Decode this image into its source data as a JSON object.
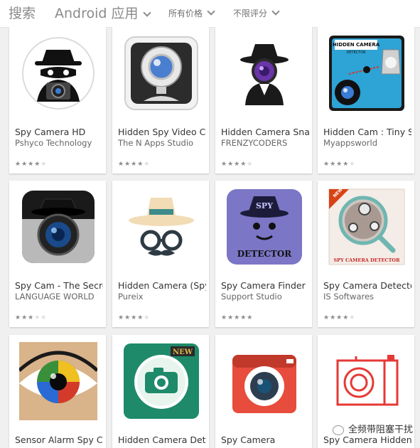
{
  "header": {
    "search_label": "搜索",
    "category_label": "Android 应用",
    "price_filter": "所有价格",
    "rating_filter": "不限评分"
  },
  "apps": [
    {
      "title": "Spy Camera HD",
      "developer": "Pshyco Technology",
      "rating": 4
    },
    {
      "title": "Hidden Spy Video Camera",
      "developer": "The N Apps Studio",
      "rating": 4
    },
    {
      "title": "Hidden Camera Snap",
      "developer": "FRENZYCODERS",
      "rating": 4.5
    },
    {
      "title": "Hidden Cam : Tiny Spy",
      "developer": "Myappsworld",
      "rating": 4.5
    },
    {
      "title": "Spy Cam - The Secret",
      "developer": "LANGUAGE WORLD",
      "rating": 3.5
    },
    {
      "title": "Hidden Camera (Spy)",
      "developer": "Pureix",
      "rating": 4
    },
    {
      "title": "Spy Camera Finder",
      "developer": "Support Studio",
      "rating": 5
    },
    {
      "title": "Spy Camera Detector",
      "developer": "IS Softwares",
      "rating": 4.5
    },
    {
      "title": "Sensor Alarm Spy Camera",
      "developer": "",
      "rating": 0
    },
    {
      "title": "Hidden Camera Detector",
      "developer": "",
      "rating": 0
    },
    {
      "title": "Spy Camera",
      "developer": "",
      "rating": 0
    },
    {
      "title": "Spy Camera Hidden",
      "developer": "",
      "rating": 0
    }
  ],
  "icon_text": {
    "hidden_camera_top": "HIDDEN CAMERA",
    "hidden_camera_sub": "DETECTOR",
    "spy": "SPY",
    "detector": "DETECTOR",
    "spy_camera_detector": "SPY CAMERA DETECTOR",
    "new": "NEW"
  },
  "watermark": "全频带阻塞干扰"
}
